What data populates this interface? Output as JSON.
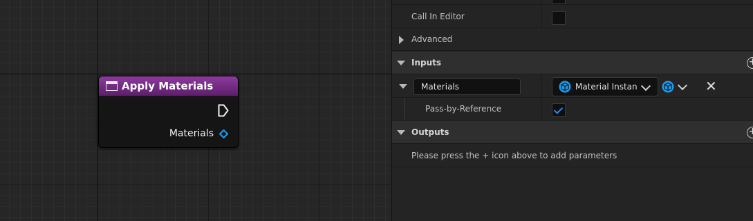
{
  "node": {
    "title": "Apply Materials",
    "output_pin_label": "Materials",
    "header_color": "#7a2f8a",
    "pin_color": "#1e9ae8"
  },
  "details": {
    "call_in_editor_label": "Call In Editor",
    "advanced_label": "Advanced",
    "inputs_label": "Inputs",
    "input_param": {
      "name": "Materials",
      "type": "Material Instan",
      "pass_by_ref_label": "Pass-by-Reference",
      "pass_by_ref_checked": true
    },
    "outputs_label": "Outputs",
    "outputs_hint": "Please press the + icon above to add parameters",
    "plus_glyph": "+",
    "remove_glyph": "✕"
  }
}
